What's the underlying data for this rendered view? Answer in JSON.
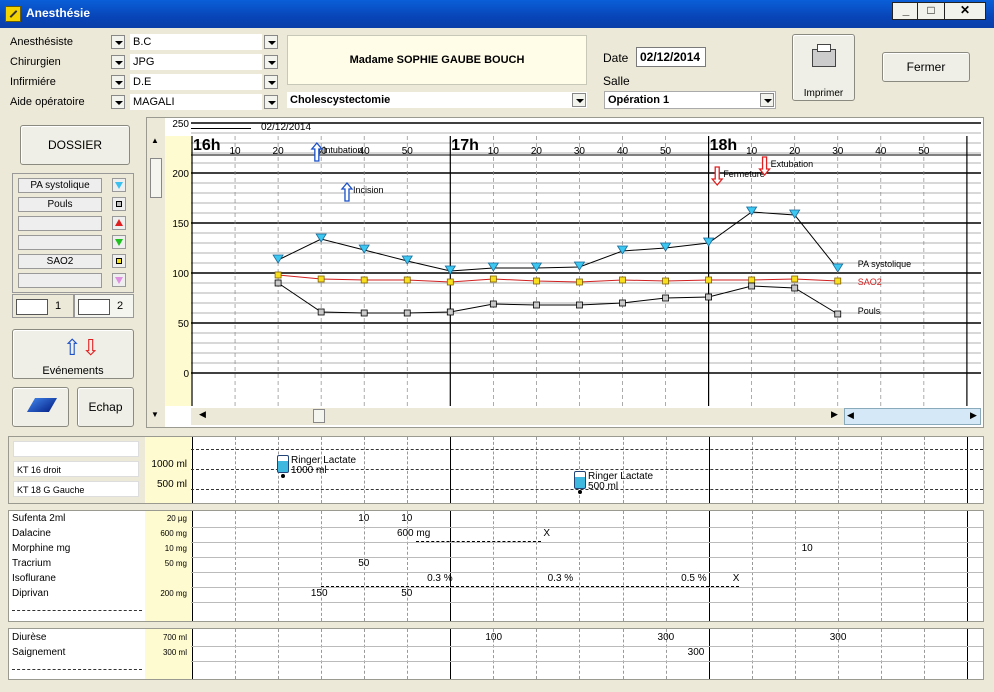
{
  "window": {
    "title": "Anesthésie"
  },
  "staff": [
    {
      "label": "Anesthésiste",
      "value": "B.C"
    },
    {
      "label": "Chirurgien",
      "value": "JPG"
    },
    {
      "label": "Infirmiére",
      "value": "D.E"
    },
    {
      "label": "Aide opératoire",
      "value": "MAGALI"
    }
  ],
  "patient": {
    "name": "Madame SOPHIE  GAUBE BOUCH",
    "procedure": "Cholescystectomie"
  },
  "date": {
    "label": "Date",
    "value": "02/12/2014"
  },
  "salle": {
    "label": "Salle",
    "value": "Opération 1"
  },
  "buttons": {
    "print": "Imprimer",
    "close": "Fermer",
    "dossier": "DOSSIER",
    "events": "Evénements",
    "escape": "Echap"
  },
  "params": [
    "PA systolique",
    "Pouls",
    "",
    "",
    "SAO2",
    ""
  ],
  "param_colors": [
    "#3cc0f0",
    "#c0c0c0",
    "#e02020",
    "#20c020",
    "#f0e020",
    "#e090e0"
  ],
  "tabs": [
    "1",
    "2"
  ],
  "timeline": {
    "date": "02/12/2014",
    "hours": [
      "16h",
      "17h",
      "18h"
    ],
    "minute_labels": [
      "10",
      "20",
      "30",
      "40",
      "50",
      "10",
      "20",
      "30",
      "40",
      "50",
      "10",
      "20",
      "30",
      "40",
      "50"
    ]
  },
  "events": [
    {
      "label": "Intubation",
      "dir": "up",
      "color": "#1a50c8"
    },
    {
      "label": "Incision",
      "dir": "up",
      "color": "#1a50c8"
    },
    {
      "label": "Fermeture",
      "dir": "down",
      "color": "#e02020"
    },
    {
      "label": "Extubation",
      "dir": "down",
      "color": "#e02020"
    }
  ],
  "chart_data": {
    "type": "line",
    "ylim": [
      0,
      250
    ],
    "yticks": [
      0,
      50,
      100,
      150,
      200,
      250
    ],
    "x_unit": "minutes after 16h",
    "series": [
      {
        "name": "PA systolique",
        "color": "#000",
        "marker": "tri-blue",
        "x": [
          20,
          30,
          40,
          50,
          60,
          70,
          80,
          90,
          100,
          110,
          120,
          130,
          140,
          150
        ],
        "y": [
          113,
          134,
          123,
          112,
          102,
          105,
          105,
          106,
          122,
          125,
          130,
          161,
          158,
          104
        ]
      },
      {
        "name": "SAO2",
        "color": "#d02020",
        "marker": "sq-yellow",
        "x": [
          20,
          30,
          40,
          50,
          60,
          70,
          80,
          90,
          100,
          110,
          120,
          130,
          140,
          150
        ],
        "y": [
          98,
          94,
          93,
          93,
          91,
          94,
          92,
          91,
          93,
          92,
          93,
          93,
          94,
          92
        ]
      },
      {
        "name": "Pouls",
        "color": "#000",
        "marker": "sq-grey",
        "x": [
          20,
          30,
          40,
          50,
          60,
          70,
          80,
          90,
          100,
          110,
          120,
          130,
          140,
          150
        ],
        "y": [
          90,
          61,
          60,
          60,
          61,
          69,
          68,
          68,
          70,
          75,
          76,
          87,
          85,
          59
        ]
      }
    ]
  },
  "perfusion": {
    "lines": [
      "",
      "KT 16 droit",
      "KT 18 G Gauche"
    ],
    "scale": [
      "1000 ml",
      "500 ml"
    ],
    "items": [
      {
        "label": "Ringer Lactate",
        "volume": "1000 ml"
      },
      {
        "label": "Ringer Lactate",
        "volume": "500 ml"
      }
    ]
  },
  "drugs": [
    {
      "name": "Sufenta 2ml",
      "unit": "20 µg",
      "cells": [
        {
          "t": 40,
          "v": "10"
        },
        {
          "t": 50,
          "v": "10"
        }
      ]
    },
    {
      "name": "Dalacine",
      "unit": "600 mg",
      "cells": [
        {
          "t": 49,
          "v": "600 mg"
        },
        {
          "t": 83,
          "v": "X"
        }
      ]
    },
    {
      "name": "Morphine mg",
      "unit": "10 mg",
      "cells": [
        {
          "t": 143,
          "v": "10"
        }
      ]
    },
    {
      "name": "Tracrium",
      "unit": "50 mg",
      "cells": [
        {
          "t": 40,
          "v": "50"
        }
      ]
    },
    {
      "name": "Isoflurane",
      "unit": "",
      "cells": [
        {
          "t": 56,
          "v": "0.3 %"
        },
        {
          "t": 84,
          "v": "0.3 %"
        },
        {
          "t": 115,
          "v": "0.5 %"
        },
        {
          "t": 127,
          "v": "X"
        }
      ]
    },
    {
      "name": "Diprivan",
      "unit": "200 mg",
      "cells": [
        {
          "t": 29,
          "v": "150"
        },
        {
          "t": 50,
          "v": "50"
        }
      ]
    }
  ],
  "outputs": [
    {
      "name": "Diurèse",
      "unit": "700 ml",
      "cells": [
        {
          "t": 70,
          "v": "100"
        },
        {
          "t": 110,
          "v": "300"
        },
        {
          "t": 150,
          "v": "300"
        }
      ]
    },
    {
      "name": "Saignement",
      "unit": "300 ml",
      "cells": [
        {
          "t": 117,
          "v": "300"
        }
      ]
    }
  ]
}
